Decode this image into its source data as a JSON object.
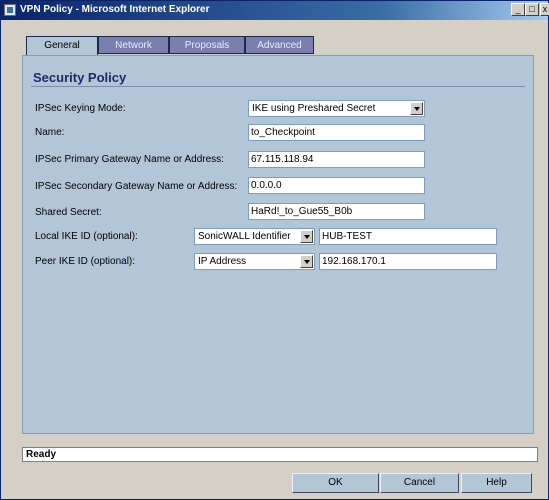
{
  "window": {
    "title": "VPN Policy - Microsoft Internet Explorer",
    "controls": {
      "minimize": "_",
      "maximize": "□",
      "close": "x"
    }
  },
  "tabs": [
    {
      "label": "General",
      "active": true
    },
    {
      "label": "Network",
      "active": false
    },
    {
      "label": "Proposals",
      "active": false
    },
    {
      "label": "Advanced",
      "active": false
    }
  ],
  "section": {
    "title": "Security Policy"
  },
  "form": {
    "keying_mode": {
      "label": "IPSec Keying Mode:",
      "value": "IKE using Preshared Secret"
    },
    "name": {
      "label": "Name:",
      "value": "to_Checkpoint"
    },
    "primary_gateway": {
      "label": "IPSec Primary Gateway Name or Address:",
      "value": "67.115.118.94"
    },
    "secondary_gateway": {
      "label": "IPSec Secondary Gateway Name or Address:",
      "value": "0.0.0.0"
    },
    "shared_secret": {
      "label": "Shared Secret:",
      "value": "HaRd!_to_Gue55_B0b"
    },
    "local_ike": {
      "label": "Local IKE ID (optional):",
      "type": "SonicWALL Identifier",
      "value": "HUB-TEST"
    },
    "peer_ike": {
      "label": "Peer IKE ID (optional):",
      "type": "IP Address",
      "value": "192.168.170.1"
    }
  },
  "status": {
    "text": "Ready"
  },
  "buttons": {
    "ok": "OK",
    "cancel": "Cancel",
    "help": "Help"
  },
  "colors": {
    "panel": "#b3c6d8",
    "active_tab": "#b3c6d8",
    "inactive_tab": "#7a7fb0",
    "title_bar": "#0a246a",
    "heading": "#1c2a6a"
  }
}
